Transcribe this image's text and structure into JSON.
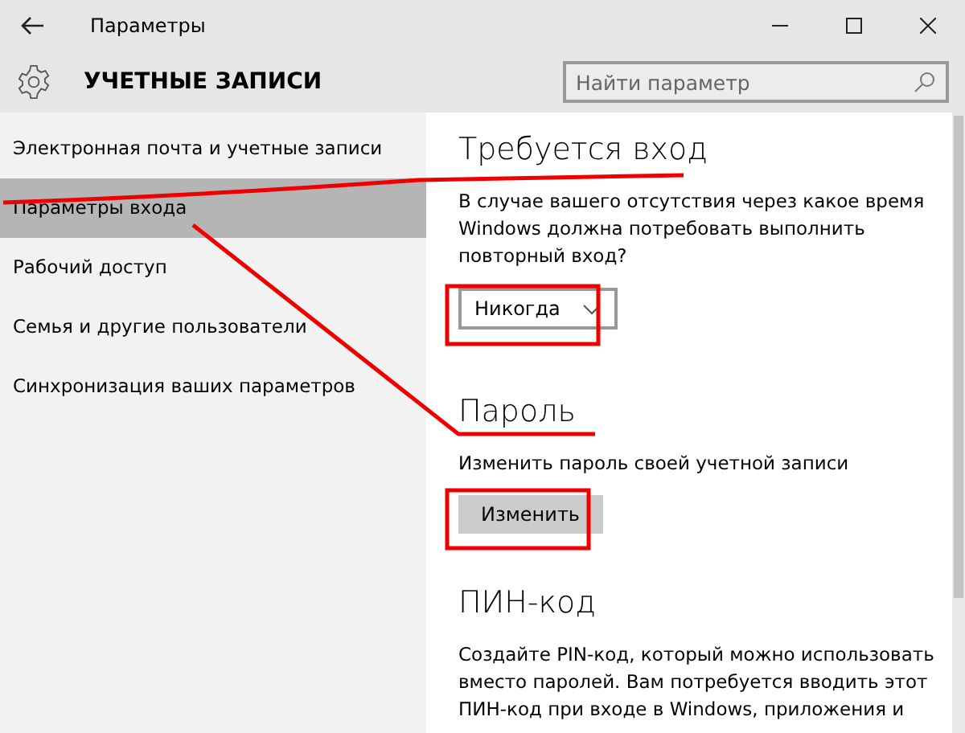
{
  "window": {
    "title": "Параметры"
  },
  "header": {
    "title": "УЧЕТНЫЕ ЗАПИСИ",
    "search": {
      "placeholder": "Найти параметр"
    }
  },
  "sidebar": {
    "items": [
      {
        "label": "Электронная почта и учетные записи",
        "selected": false
      },
      {
        "label": "Параметры входа",
        "selected": true
      },
      {
        "label": "Рабочий доступ",
        "selected": false
      },
      {
        "label": "Семья и другие пользователи",
        "selected": false
      },
      {
        "label": "Синхронизация ваших параметров",
        "selected": false
      }
    ]
  },
  "sections": [
    {
      "heading": "Требуется вход",
      "text": "В случае вашего отсутствия через какое время Windows должна потребовать выполнить повторный вход?",
      "control": {
        "kind": "dropdown",
        "value": "Никогда"
      }
    },
    {
      "heading": "Пароль",
      "text": "Изменить пароль своей учетной записи",
      "control": {
        "kind": "button",
        "label": "Изменить"
      }
    },
    {
      "heading": "ПИН-код",
      "text": "Создайте PIN-код, который можно использовать вместо паролей. Вам потребуется вводить этот ПИН-код при входе в Windows, приложения и"
    }
  ]
}
